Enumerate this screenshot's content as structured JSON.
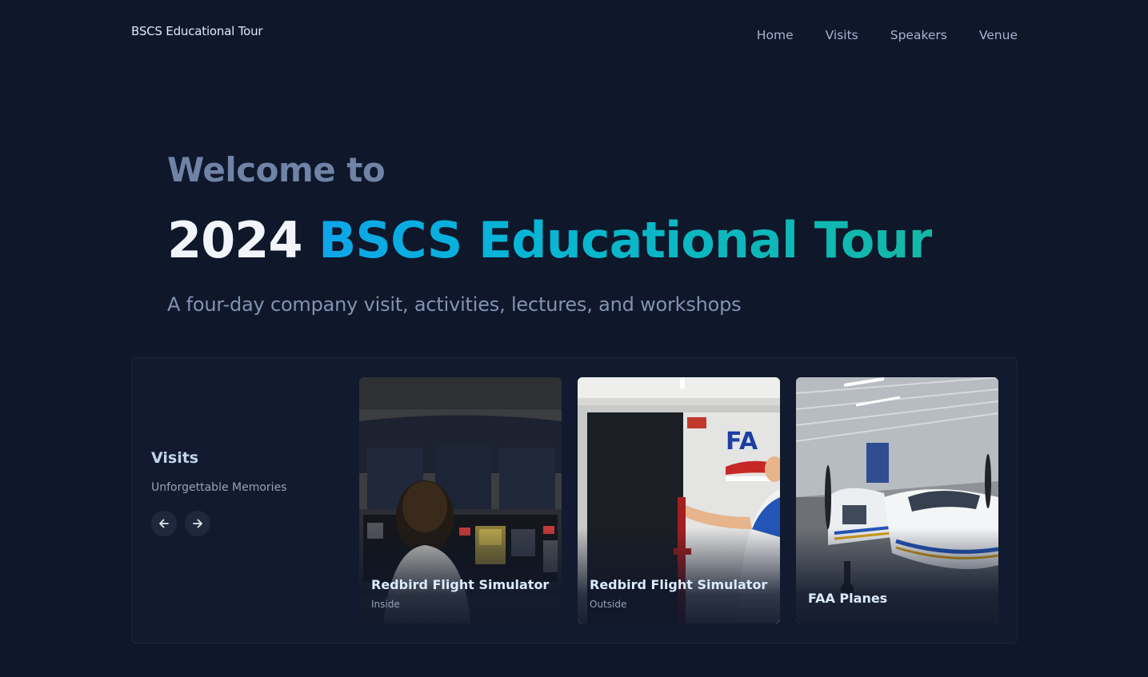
{
  "header": {
    "brand": "BSCS Educational Tour",
    "nav": [
      "Home",
      "Visits",
      "Speakers",
      "Venue"
    ]
  },
  "hero": {
    "welcome": "Welcome to",
    "title_year": "2024",
    "title_accent": "BSCS Educational Tour",
    "subtitle": "A four-day company visit, activities, lectures, and workshops"
  },
  "visits": {
    "title": "Visits",
    "subtitle": "Unforgettable Memories",
    "prev_icon": "arrow-left-icon",
    "next_icon": "arrow-right-icon",
    "cards": [
      {
        "title": "Redbird Flight Simulator",
        "subtitle": "Inside",
        "image": "flight-simulator-cockpit-photo"
      },
      {
        "title": "Redbird Flight Simulator",
        "subtitle": "Outside",
        "image": "flight-simulator-exterior-photo"
      },
      {
        "title": "FAA Planes",
        "subtitle": "",
        "image": "hangar-airplanes-photo"
      }
    ]
  },
  "colors": {
    "background": "#0f172a",
    "accent_start": "#0ea5e9",
    "accent_end": "#14b8a6"
  }
}
